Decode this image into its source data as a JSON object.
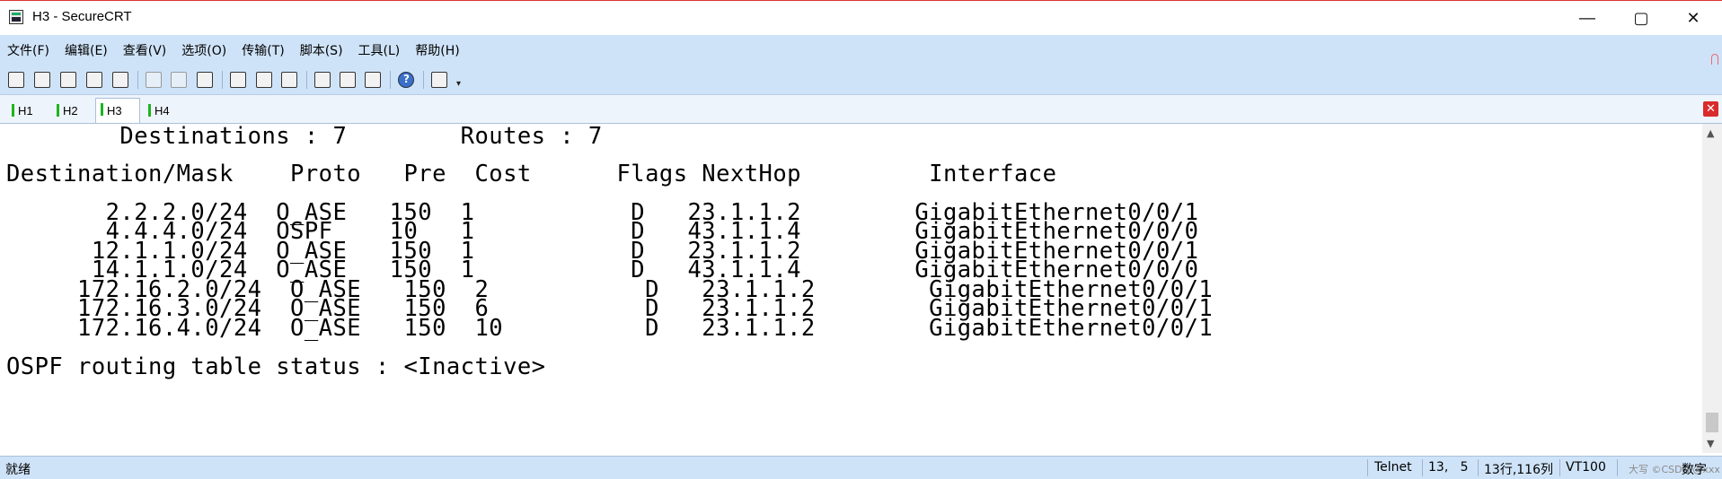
{
  "window": {
    "title": "H3 - SecureCRT"
  },
  "menu": [
    "文件(F)",
    "编辑(E)",
    "查看(V)",
    "选项(O)",
    "传输(T)",
    "脚本(S)",
    "工具(L)",
    "帮助(H)"
  ],
  "tabs": [
    {
      "label": "H1",
      "active": false
    },
    {
      "label": "H2",
      "active": false
    },
    {
      "label": "H3",
      "active": true
    },
    {
      "label": "H4",
      "active": false
    }
  ],
  "terminal": {
    "summary": "        Destinations : 7        Routes : 7",
    "header": "Destination/Mask    Proto   Pre  Cost      Flags NextHop         Interface",
    "rows": [
      "       2.2.2.0/24  O_ASE   150  1           D   23.1.1.2        GigabitEthernet0/0/1",
      "       4.4.4.0/24  OSPF    10   1           D   43.1.1.4        GigabitEthernet0/0/0",
      "      12.1.1.0/24  O_ASE   150  1           D   23.1.1.2        GigabitEthernet0/0/1",
      "      14.1.1.0/24  O_ASE   150  1           D   43.1.1.4        GigabitEthernet0/0/0",
      "     172.16.2.0/24  O_ASE   150  2           D   23.1.1.2        GigabitEthernet0/0/1",
      "     172.16.3.0/24  O_ASE   150  6           D   23.1.1.2        GigabitEthernet0/0/1",
      "     172.16.4.0/24  O_ASE   150  10          D   23.1.1.2        GigabitEthernet0/0/1"
    ],
    "status_line": "OSPF routing table status : <Inactive>"
  },
  "statusbar": {
    "ready": "就绪",
    "protocol": "Telnet",
    "cursor": "13,   5",
    "dims": "13行,116列",
    "emulation": "VT100",
    "numlock": "数字",
    "watermark": "大写 ©CSDN @xxx"
  },
  "colors": {
    "chrome": "#cfe3f8",
    "tab_indicator": "#1fb31f",
    "close_red": "#d92b2b"
  }
}
